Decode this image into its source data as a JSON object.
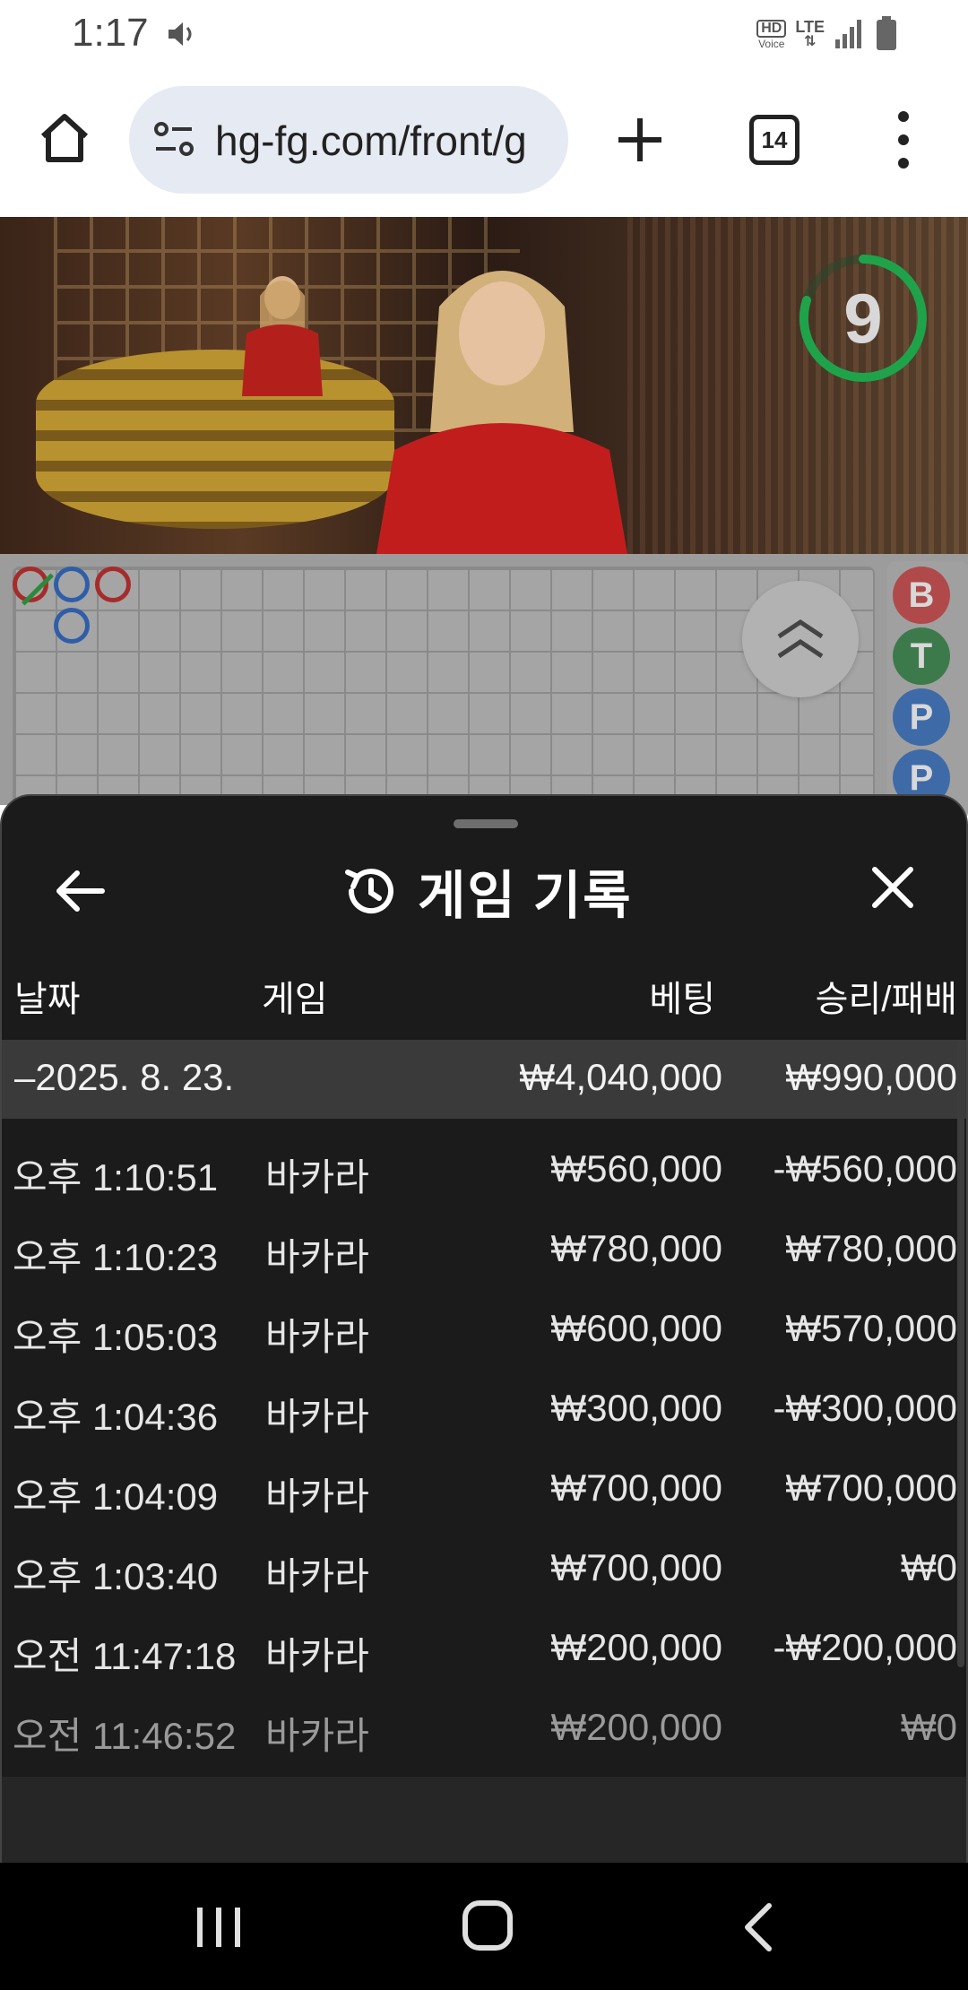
{
  "status_bar": {
    "time": "1:17",
    "hd_label": "HD",
    "voice_label": "Voice",
    "network_label": "LTE"
  },
  "browser": {
    "url": "hg-fg.com/front/g",
    "tab_count": "14"
  },
  "video": {
    "countdown": "9"
  },
  "roadmap": {
    "big_road": [
      "B",
      "T",
      "P",
      "P"
    ]
  },
  "history": {
    "title": "게임 기록",
    "columns": {
      "date": "날짜",
      "game": "게임",
      "bet": "베팅",
      "win_loss": "승리/패배"
    },
    "date_group": {
      "date": "–2025. 8. 23.",
      "bet_total": "₩4,040,000",
      "win_total": "₩990,000"
    },
    "rows": [
      {
        "time": "오후 1:10:51",
        "game": "바카라",
        "bet": "₩560,000",
        "result": "-₩560,000"
      },
      {
        "time": "오후 1:10:23",
        "game": "바카라",
        "bet": "₩780,000",
        "result": "₩780,000"
      },
      {
        "time": "오후 1:05:03",
        "game": "바카라",
        "bet": "₩600,000",
        "result": "₩570,000"
      },
      {
        "time": "오후 1:04:36",
        "game": "바카라",
        "bet": "₩300,000",
        "result": "-₩300,000"
      },
      {
        "time": "오후 1:04:09",
        "game": "바카라",
        "bet": "₩700,000",
        "result": "₩700,000"
      },
      {
        "time": "오후 1:03:40",
        "game": "바카라",
        "bet": "₩700,000",
        "result": "₩0"
      },
      {
        "time": "오전 11:47:18",
        "game": "바카라",
        "bet": "₩200,000",
        "result": "-₩200,000"
      },
      {
        "time": "오전 11:46:52",
        "game": "바카라",
        "bet": "₩200,000",
        "result": "₩0"
      }
    ]
  },
  "colors": {
    "sheet_bg": "#1b1b1b",
    "banker_red": "#a62b2b",
    "player_blue": "#2f5ea8",
    "tie_green": "#2b8a3a",
    "timer_green": "#1fa34a"
  }
}
